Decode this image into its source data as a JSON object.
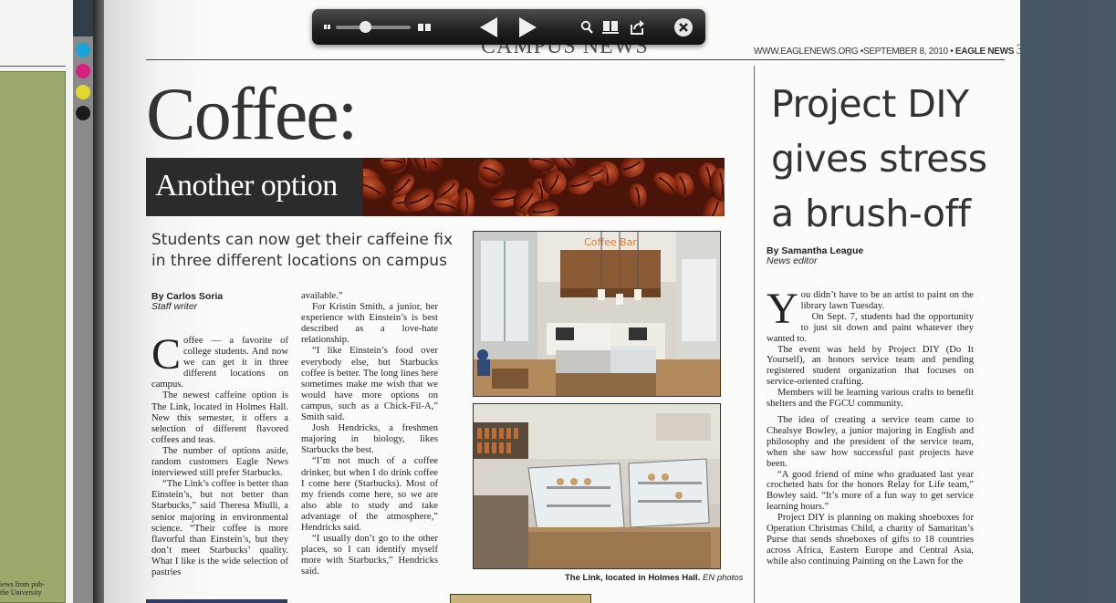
{
  "toolbar": {
    "zoom_out_icon": "zoom-out-icon",
    "zoom_slider_value": 0.4,
    "zoom_in_icon": "zoom-in-icon",
    "prev_icon": "prev-page-icon",
    "next_icon": "next-page-icon",
    "search_icon": "search-icon",
    "thumbnails_icon": "thumbnails-icon",
    "share_icon": "share-icon",
    "close_icon": "close-icon"
  },
  "left_page": {
    "snippet": "iews from pub- the University"
  },
  "registration_colors": [
    "#1aa3d8",
    "#d61f7e",
    "#e3d82c",
    "#1b1b1b"
  ],
  "header": {
    "section": "CAMPUS NEWS",
    "url_date": "WWW.EAGLENEWS.ORG •SEPTEMBER 8, 2010 •",
    "paper": "EAGLE NEWS",
    "page_number": "3"
  },
  "coffee": {
    "title": "Coffee:",
    "banner": "Another option",
    "deck": "Students can now get their caffeine fix in three different locations on campus",
    "byline_name": "By Carlos Soria",
    "byline_role": "Staff writer",
    "dropcap": "C",
    "col1": [
      "offee — a favorite of college students. And now we can get it in three different locations on campus.",
      "The newest caffeine option is The Link, located in Holmes Hall. New this semester, it offers a selection of different flavored coffees and teas.",
      "The number of options aside, random customers Eagle News interviewed still prefer Starbucks.",
      "“The Link’s coffee is better than Einstein’s, but not better than Starbucks,” said Theresa Miulli, a senior majoring in environmental science. “Their coffee is more flavorful than Einstein’s, but they don’t meet Starbucks’ quality. What I like is the wide selection of pastries"
    ],
    "col2": [
      "available.”",
      "For Kristin Smith, a junior, her experience with Einstein’s is best described as a love-hate relationship.",
      "“I like Einstein’s food over everybody else, but Starbucks coffee is better. The long lines here sometimes make me wish that we would have more options on campus, such as a Chick-Fil-A,” Smith said.",
      "Josh Hendricks, a freshmen majoring in biology, likes Starbucks the best.",
      "“I’m not much of a coffee drinker, but when I do drink coffee I come here (Starbucks). Most of my friends come here, so we are also able to study and take advantage of the atmosphere,” Hendricks said.",
      "“I usually don’t go to the other places, so I can identify myself more with Starbucks,” Hendricks said."
    ],
    "caption_bold": "The Link, located in Holmes Hall.",
    "caption_credit": "EN photos",
    "sign_text": "Coffee Bar"
  },
  "diy": {
    "title": "Project DIY gives stress a brush-off",
    "byline_name": "By Samantha League",
    "byline_role": "News editor",
    "dropcap": "Y",
    "paragraphs": [
      "ou didn’t have to be an artist to paint on the library lawn Tuesday.",
      "On Sept. 7, students had the opportunity to just sit down and paint whatever they wanted to.",
      "The event was held by Project DIY (Do It Yourself), an honors service team and pending registered student organization that focuses on service-oriented crafting.",
      "Members will be learning various crafts to benefit shelters and the FGCU community.",
      "The idea of creating a service team came to Chealsye Bowley, a junior majoring in English and philosophy and the president of the service team, when she saw how successful past projects have been.",
      "“A good friend of mine who graduated last year crocheted hats for the honors Relay for Life team,” Bowley said. “It’s more of a fun way to get service learning hours.”",
      "Project DIY is planning on making shoeboxes for Operation Christmas Child, a charity of Samaritan’s Purse that sends shoeboxes of gifts to 18 countries across Africa, Eastern Europe and Central Asia, while also continuing Painting on the Lawn for the"
    ]
  }
}
